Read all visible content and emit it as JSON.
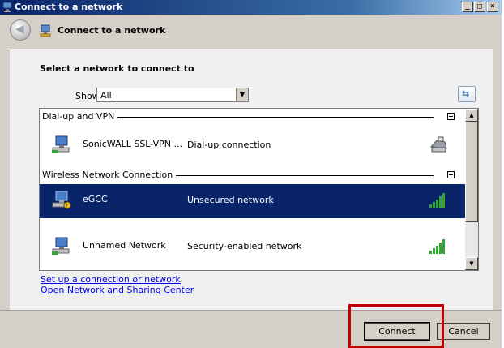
{
  "window": {
    "title": "Connect to a network",
    "controls": {
      "minimize": "_",
      "maximize": "□",
      "close": "×"
    }
  },
  "header": {
    "back_icon": "back-arrow-icon",
    "title": "Connect to a network"
  },
  "content": {
    "heading": "Select a network to connect to",
    "show_label": "Show",
    "show_value": "All",
    "groups": [
      {
        "label": "Dial-up and VPN",
        "items": [
          {
            "name": "SonicWALL SSL-VPN ...",
            "description": "Dial-up connection",
            "status_icon": "phone-icon",
            "selected": false
          }
        ]
      },
      {
        "label": "Wireless Network Connection",
        "items": [
          {
            "name": "eGCC",
            "description": "Unsecured network",
            "status_icon": "signal-strength-icon",
            "selected": true
          },
          {
            "name": "Unnamed Network",
            "description": "Security-enabled network",
            "status_icon": "signal-strength-icon",
            "selected": false
          }
        ]
      }
    ],
    "links": {
      "setup": "Set up a connection or network",
      "sharing": "Open Network and Sharing Center"
    }
  },
  "footer": {
    "connect_label": "Connect",
    "cancel_label": "Cancel"
  },
  "colors": {
    "selection": "#0a246a",
    "highlight": "#c00000",
    "signal": "#2ea82e"
  }
}
